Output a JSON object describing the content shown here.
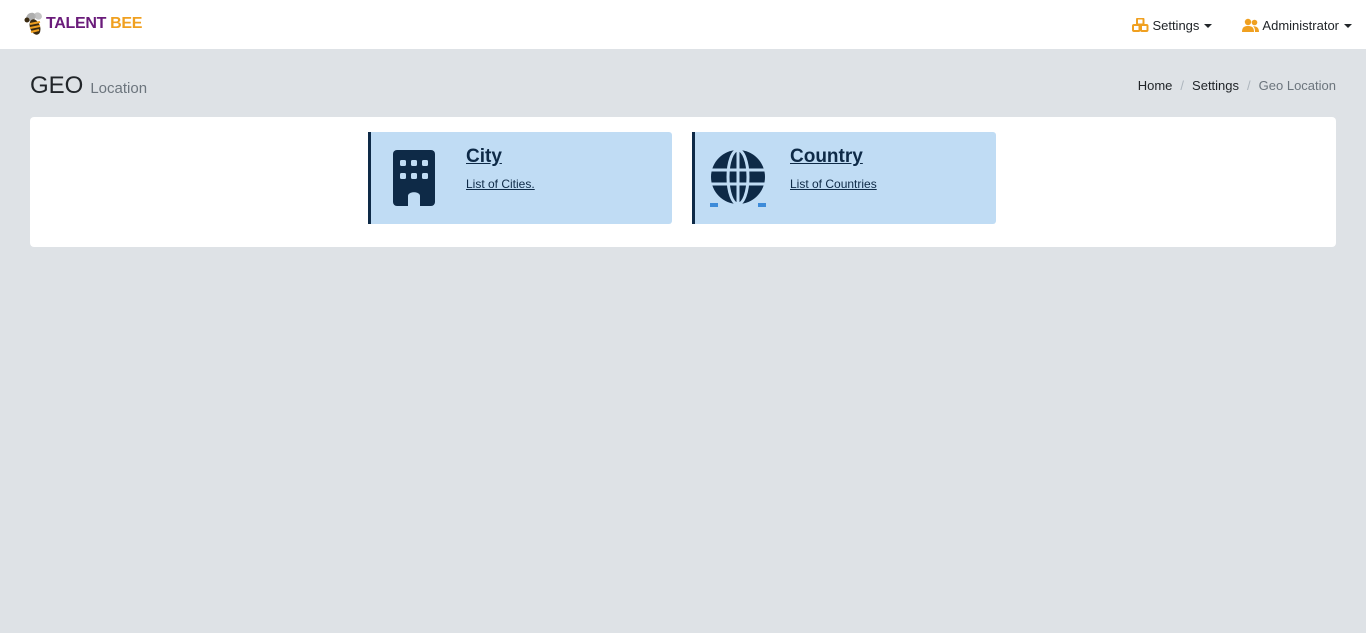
{
  "navbar": {
    "brand": {
      "word1": "TALENT",
      "word2": "BEE",
      "icon": "bee-logo"
    },
    "settings": {
      "label": "Settings",
      "icon": "cubes-icon",
      "color": "#f0a020"
    },
    "user": {
      "label": "Administrator",
      "icon": "users-icon",
      "color": "#f0a020"
    }
  },
  "page": {
    "title": "GEO",
    "subtitle": "Location"
  },
  "breadcrumb": [
    {
      "label": "Home"
    },
    {
      "label": "Settings"
    },
    {
      "label": "Geo Location",
      "active": true
    }
  ],
  "breadcrumb_separator": "/",
  "tiles": [
    {
      "title": "City",
      "link": "List of Cities.",
      "icon": "building-icon"
    },
    {
      "title": "Country",
      "link": "List of Countries",
      "icon": "globe-icon"
    }
  ],
  "colors": {
    "tile_bg": "#c0dcf4",
    "tile_accent": "#0e2a47",
    "page_bg": "#dee2e6",
    "brand_purple": "#6a1b7a",
    "brand_orange": "#f0a020"
  }
}
